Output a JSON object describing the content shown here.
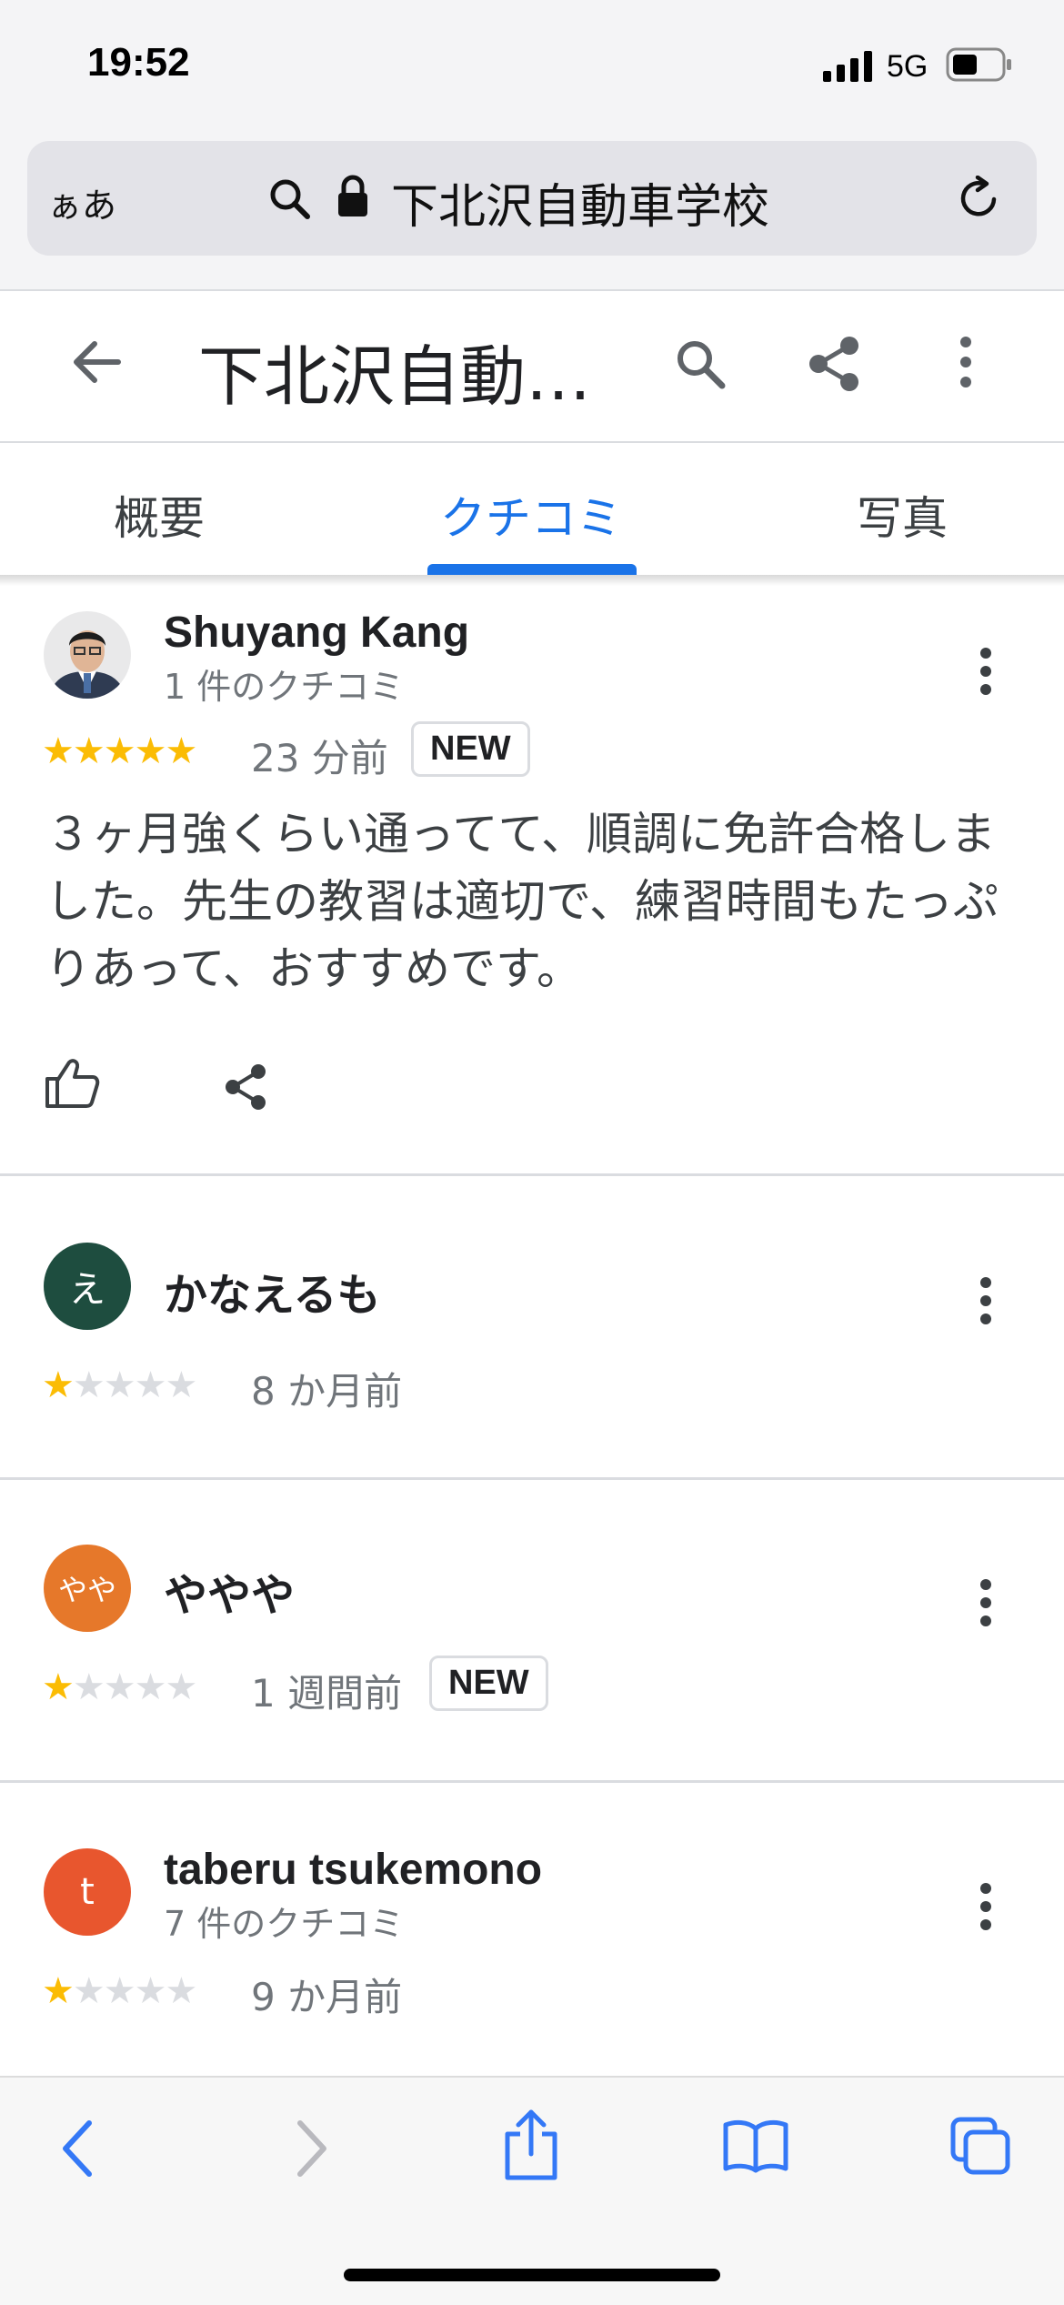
{
  "status_bar": {
    "time": "19:52",
    "network": "5G"
  },
  "safari": {
    "aa_label": "ぁあ",
    "url_text": "下北沢自動車学校"
  },
  "header": {
    "title": "下北沢自動…"
  },
  "tabs": [
    {
      "label": "概要"
    },
    {
      "label": "クチコミ",
      "active": true
    },
    {
      "label": "写真"
    }
  ],
  "reviews": [
    {
      "name": "Shuyang Kang",
      "subtitle": "1 件のクチコミ",
      "rating": 5,
      "time": "23 分前",
      "badge": "NEW",
      "text": "３ヶ月強くらい通ってて、順調に免許合格しました。先生の教習は適切で、練習時間もたっぷりあって、おすすめです。",
      "avatar_type": "photo"
    },
    {
      "name": "かなえるも",
      "avatar_letter": "え",
      "avatar_color": "#1e4d3f",
      "rating": 1,
      "time": "8 か月前"
    },
    {
      "name": "ややや",
      "avatar_letter": "やや",
      "avatar_color": "#e6782a",
      "rating": 1,
      "time": "1 週間前",
      "badge": "NEW"
    },
    {
      "name": "taberu tsukemono",
      "subtitle": "7 件のクチコミ",
      "avatar_letter": "t",
      "avatar_color": "#e8562e",
      "rating": 1,
      "time": "9 か月前"
    }
  ],
  "colors": {
    "accent": "#1a73e8",
    "star": "#fbbc04",
    "safari_blue": "#3478f6"
  },
  "icons": [
    "search-icon",
    "lock-icon",
    "reload-icon",
    "back-arrow-icon",
    "share-icon",
    "more-vert-icon",
    "thumbs-up-icon",
    "safari-back-icon",
    "safari-forward-icon",
    "safari-share-icon",
    "bookmarks-icon",
    "tabs-icon"
  ]
}
